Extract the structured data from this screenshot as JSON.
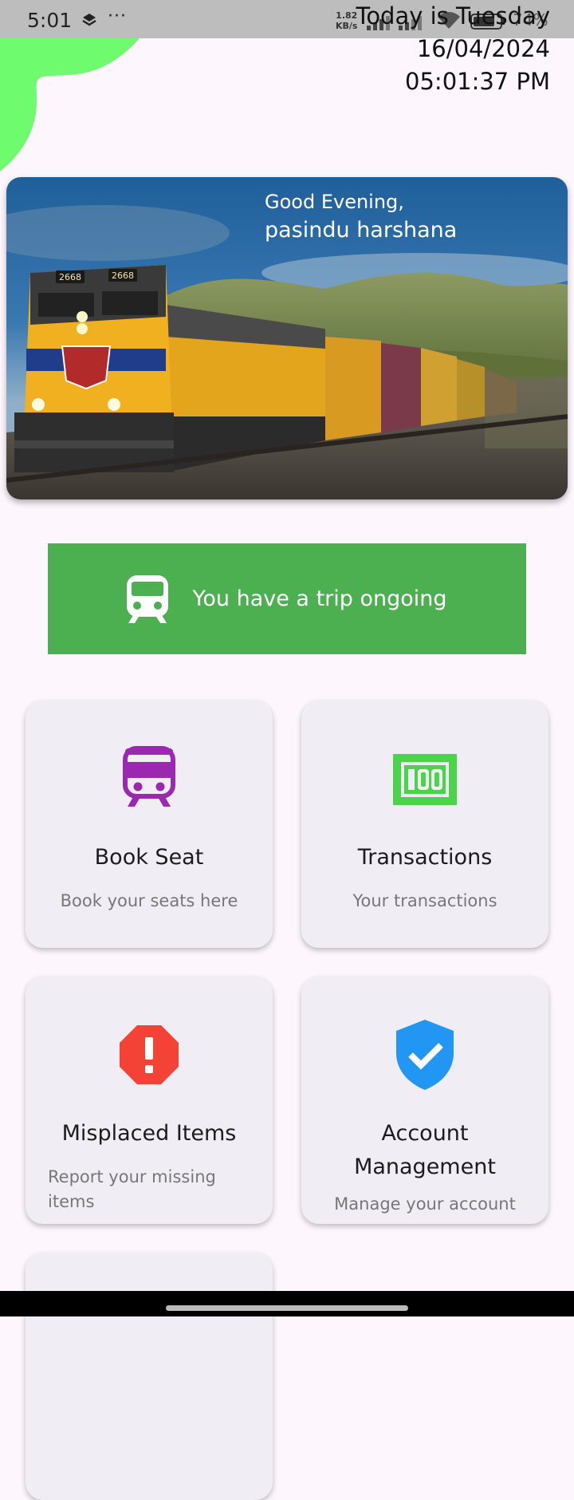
{
  "status_bar": {
    "time": "5:01",
    "dots": "···",
    "speed_value": "1.82",
    "speed_unit": "KB/s",
    "battery": "74%"
  },
  "header": {
    "day_text": "Today is Tuesday",
    "date": "16/04/2024",
    "time": "05:01:37 PM"
  },
  "hero": {
    "greeting": "Good Evening,",
    "user_name": "pasindu harshana",
    "loco_numbers": [
      "2668",
      "2668"
    ]
  },
  "trip_banner": {
    "label": "You have a trip ongoing",
    "icon": "train-icon"
  },
  "cards": [
    {
      "title": "Book Seat",
      "subtitle": "Book your seats here",
      "icon": "train-front-icon",
      "icon_color": "#9c27b0"
    },
    {
      "title": "Transactions",
      "subtitle": "Your transactions",
      "icon": "hundred-icon",
      "icon_color": "#4cd34c"
    },
    {
      "title": "Misplaced Items",
      "subtitle": "Report your missing items",
      "icon": "error-octagon-icon",
      "icon_color": "#f44336"
    },
    {
      "title": "Account Management",
      "subtitle": "Manage your account",
      "icon": "verified-shield-icon",
      "icon_color": "#2196f3"
    }
  ],
  "colors": {
    "background": "#fdf7fd",
    "banner_green": "#4caf50",
    "card_bg": "#f0eef4",
    "blob_green": "#6efc6e"
  }
}
